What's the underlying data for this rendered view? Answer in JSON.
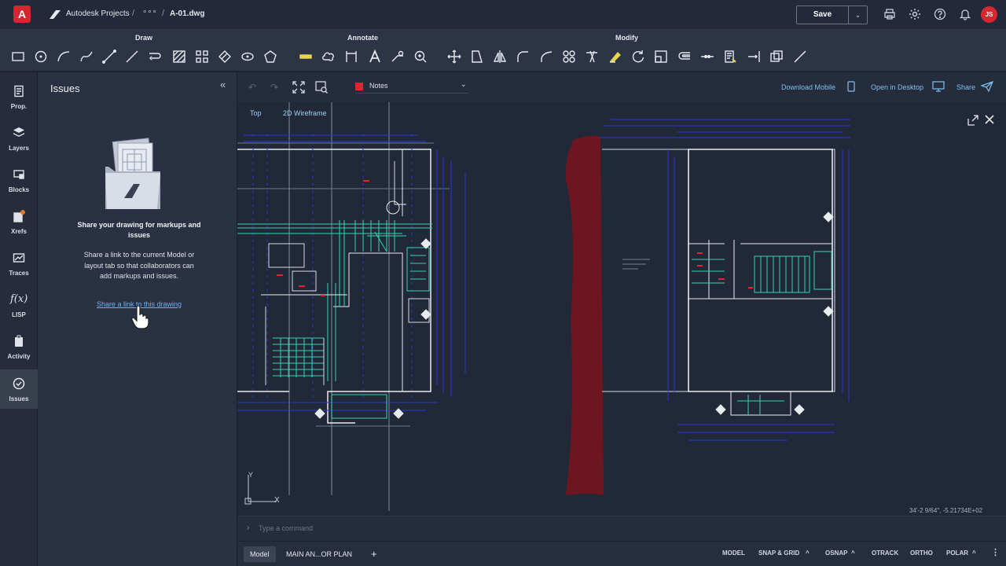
{
  "topbar": {
    "logo": "A",
    "project": "Autodesk Projects",
    "sep": "/",
    "ellipsis": "∘∘∘",
    "file": "A-01.dwg",
    "save": "Save",
    "avatar": "JS"
  },
  "ribbon": {
    "groups": [
      "Draw",
      "Annotate",
      "Modify"
    ]
  },
  "rail": {
    "items": [
      "Prop.",
      "Layers",
      "Blocks",
      "Xrefs",
      "Traces",
      "LISP",
      "Activity",
      "Issues"
    ]
  },
  "issues": {
    "title": "Issues",
    "heading": "Share your drawing for markups and issues",
    "body": "Share a link to the current Model or layout tab so that collaborators can add markups and issues.",
    "link": "Share a link to this drawing"
  },
  "viewport": {
    "layer": "Notes",
    "view": "Top",
    "style": "2D Wireframe",
    "download": "Download Mobile",
    "open": "Open in Desktop",
    "share": "Share",
    "coords": "34'-2 9/64\", -5.21734E+02",
    "axis_y": "Y",
    "axis_x": "X"
  },
  "cmd": {
    "placeholder": "Type a command"
  },
  "status": {
    "tabs": [
      "Model",
      "MAIN AN...OR PLAN"
    ],
    "add": "+",
    "toggles": [
      "MODEL",
      "SNAP & GRID",
      "OSNAP",
      "OTRACK",
      "ORTHO",
      "POLAR"
    ]
  },
  "colors": {
    "accent": "#d7262f",
    "link": "#6fb3ef",
    "cad_blue": "#1f2fd6",
    "cad_cyan": "#35d0b5"
  }
}
